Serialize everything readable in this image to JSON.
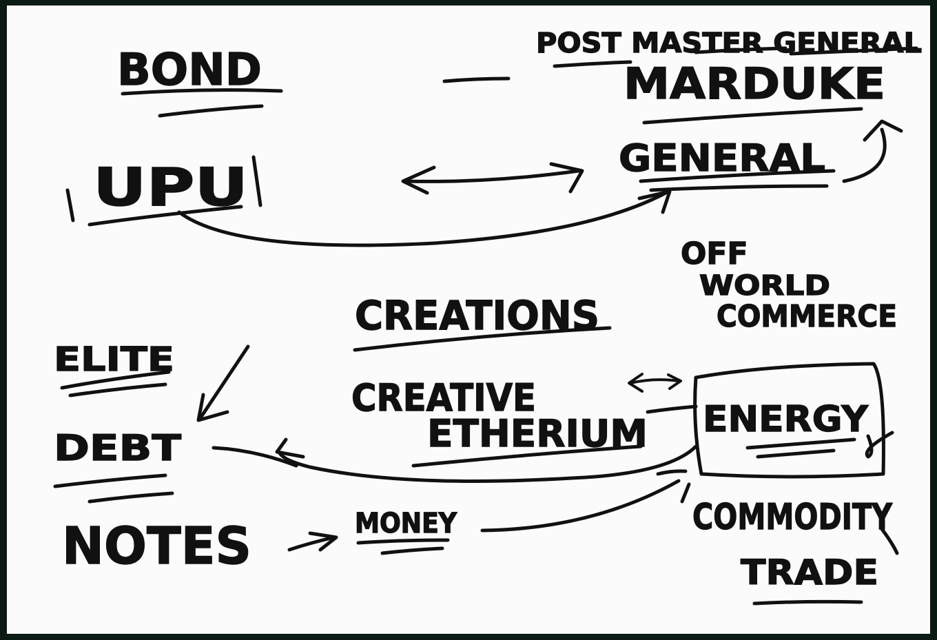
{
  "diagram": {
    "labels": {
      "bond": "BOND",
      "post_master_general": "POST MASTER GENERAL",
      "marduke": "MARDUKE",
      "upu": "UPU",
      "general": "GENERAL",
      "off_world_1": "OFF",
      "off_world_2": "WORLD",
      "off_world_3": "COMMERCE",
      "creations": "CREATIONS",
      "elite": "ELITE",
      "debt": "DEBT",
      "creative": "CREATIVE",
      "etherium": "ETHERIUM",
      "energy": "ENERGY",
      "notes": "NOTES",
      "money": "MONEY",
      "commodity": "COMMODITY",
      "trade": "TRADE"
    },
    "ink_color": "#111111",
    "board_color": "#fbfbfb",
    "frame_color": "#0c1a14"
  }
}
